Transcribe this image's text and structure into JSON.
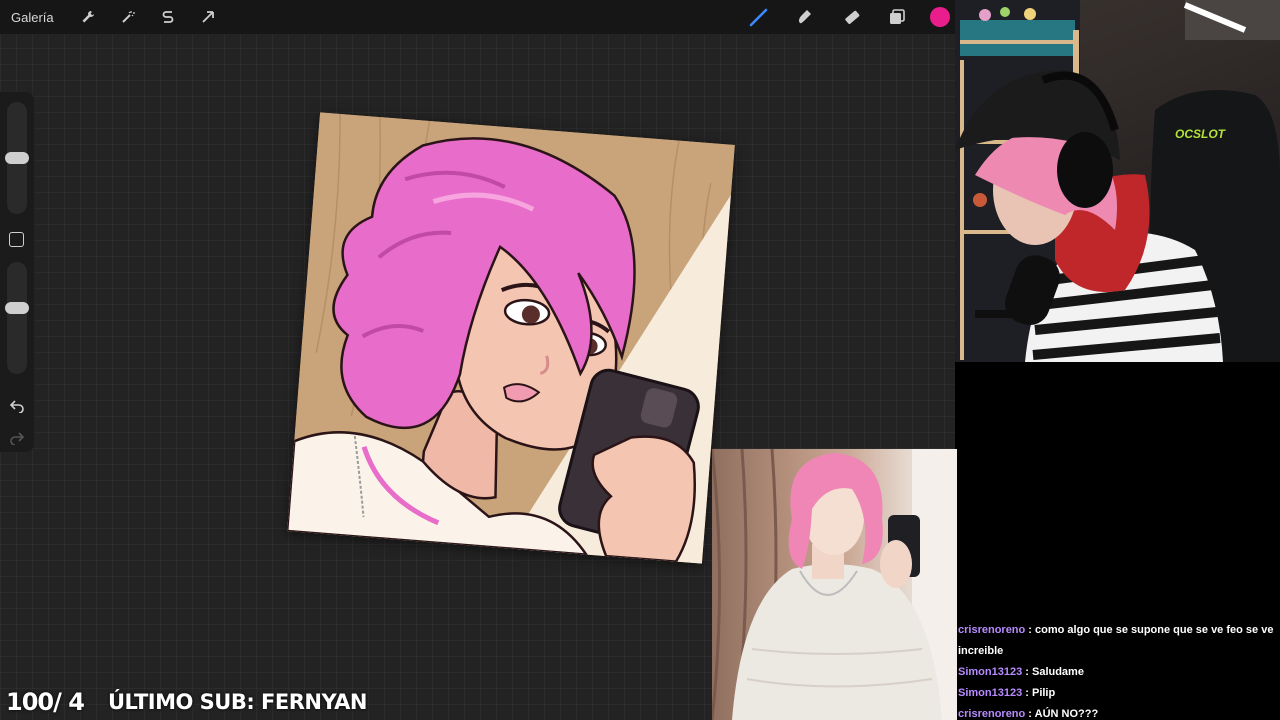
{
  "toolbar": {
    "gallery_label": "Galería",
    "left_icons": [
      "wrench-icon",
      "magic-wand-icon",
      "selection-s-icon",
      "transform-arrow-icon"
    ],
    "right_icons": [
      "brush-icon",
      "smudge-icon",
      "eraser-icon",
      "layers-icon"
    ],
    "active_color": "#e91e8c"
  },
  "sidebar": {
    "brush_size": 0.5,
    "opacity": 0.6
  },
  "overlay": {
    "sub_counter": "100/ 4",
    "last_sub": "ÚLTIMO SUB: FERNYAN"
  },
  "webcam": {
    "chair_brand": "OCSLOT"
  },
  "chat": {
    "messages": [
      {
        "user": "crisrenoreno",
        "sep": " : ",
        "text": "como algo que se supone que se ve feo se ve increible"
      },
      {
        "user": "Simon13123",
        "sep": " : ",
        "text": "Saludame"
      },
      {
        "user": "Simon13123",
        "sep": " : ",
        "text": "Pilip"
      },
      {
        "user": "crisrenoreno",
        "sep": " : ",
        "text": "AÚN NO???"
      }
    ]
  },
  "colors": {
    "canvas_bg": "#232323",
    "toolbar_bg": "#161616",
    "hair_pink": "#e86cc9",
    "chat_username": "#b78bff"
  }
}
